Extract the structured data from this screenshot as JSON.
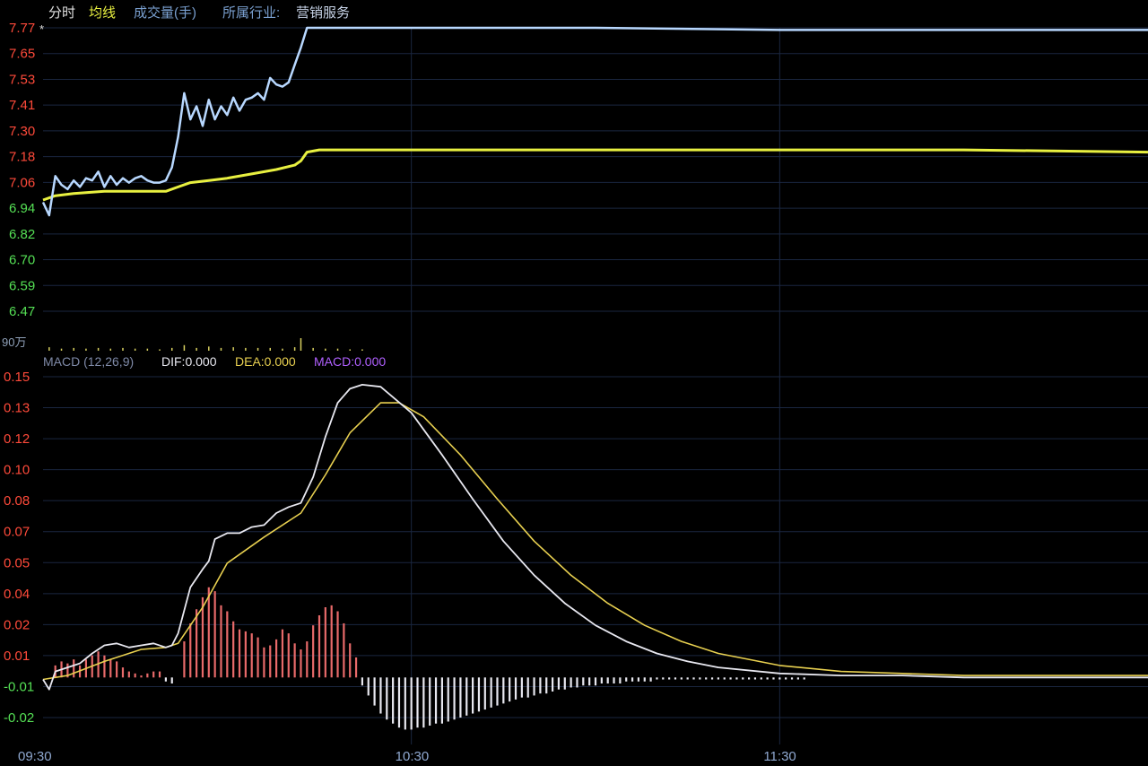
{
  "header": {
    "tab_timeshare": "分时",
    "tab_avg": "均线",
    "volume_label": "成交量(手)",
    "industry_label": "所属行业:",
    "industry_value": "营销服务"
  },
  "colors": {
    "price": "#b8d8ff",
    "avg": "#e8f040",
    "up": "#ff4a3a",
    "down": "#55e055",
    "dif": "#e8e8f0",
    "dea": "#e8d050",
    "macd_label": "#b060ff",
    "macd_pos_bar": "#e86a6a",
    "macd_neg_bar": "#e8e8f0",
    "grid": "#1a2640",
    "volume_bar": "#d8d060"
  },
  "volume_axis_label": "90万",
  "macd_header": {
    "name": "MACD (12,26,9)",
    "dif": "DIF:0.000",
    "dea": "DEA:0.000",
    "macd": "MACD:0.000"
  },
  "chart_data": [
    {
      "type": "line",
      "panel": "intraday price",
      "y_ticks": [
        "7.77",
        "7.65",
        "7.53",
        "7.41",
        "7.30",
        "7.18",
        "7.06",
        "6.94",
        "6.82",
        "6.70",
        "6.59",
        "6.47"
      ],
      "ylim": [
        6.47,
        7.77
      ],
      "x_ticks": [
        "09:30",
        "10:30",
        "11:30"
      ],
      "series": [
        {
          "name": "分时",
          "x": [
            0,
            1,
            2,
            3,
            4,
            5,
            6,
            7,
            8,
            9,
            10,
            11,
            12,
            13,
            14,
            15,
            16,
            17,
            18,
            19,
            20,
            21,
            22,
            23,
            24,
            25,
            26,
            27,
            28,
            29,
            30,
            31,
            32,
            33,
            34,
            35,
            36,
            37,
            38,
            39,
            40,
            41,
            42,
            43,
            44,
            45,
            48,
            60,
            90,
            120,
            150,
            180
          ],
          "values": [
            6.97,
            6.91,
            7.09,
            7.05,
            7.03,
            7.07,
            7.04,
            7.08,
            7.07,
            7.11,
            7.04,
            7.09,
            7.05,
            7.08,
            7.06,
            7.08,
            7.09,
            7.07,
            7.06,
            7.06,
            7.07,
            7.13,
            7.27,
            7.47,
            7.35,
            7.41,
            7.32,
            7.44,
            7.35,
            7.41,
            7.37,
            7.45,
            7.39,
            7.44,
            7.45,
            7.47,
            7.44,
            7.54,
            7.51,
            7.5,
            7.52,
            7.6,
            7.68,
            7.77,
            7.77,
            7.77,
            7.77,
            7.77,
            7.77,
            7.76,
            7.76,
            7.76
          ]
        },
        {
          "name": "均线",
          "x": [
            0,
            2,
            5,
            10,
            15,
            20,
            22,
            24,
            27,
            30,
            34,
            38,
            41,
            42,
            43,
            45,
            60,
            90,
            120,
            150,
            180
          ],
          "values": [
            6.98,
            7.0,
            7.01,
            7.02,
            7.02,
            7.02,
            7.04,
            7.06,
            7.07,
            7.08,
            7.1,
            7.12,
            7.14,
            7.16,
            7.2,
            7.21,
            7.21,
            7.21,
            7.21,
            7.21,
            7.2
          ]
        }
      ]
    },
    {
      "type": "bar",
      "panel": "volume",
      "y_label": "90万",
      "x": [
        1,
        3,
        5,
        7,
        9,
        11,
        13,
        15,
        17,
        19,
        21,
        23,
        25,
        27,
        29,
        31,
        33,
        35,
        37,
        39,
        41,
        42,
        44,
        46,
        48,
        50,
        52
      ],
      "values": [
        5,
        3,
        4,
        3,
        4,
        3,
        4,
        3,
        3,
        2,
        4,
        8,
        4,
        6,
        4,
        5,
        4,
        4,
        4,
        3,
        5,
        18,
        4,
        3,
        3,
        2,
        2
      ]
    },
    {
      "type": "line",
      "panel": "MACD",
      "y_ticks": [
        "0.15",
        "0.13",
        "0.12",
        "0.10",
        "0.08",
        "0.07",
        "0.05",
        "0.04",
        "0.02",
        "0.01",
        "-0.01",
        "-0.02"
      ],
      "ylim": [
        -0.02,
        0.15
      ],
      "series": [
        {
          "name": "DIF",
          "x": [
            0,
            1,
            2,
            4,
            6,
            8,
            10,
            12,
            14,
            16,
            18,
            20,
            21,
            22,
            24,
            26,
            27,
            28,
            30,
            32,
            34,
            36,
            38,
            40,
            42,
            44,
            46,
            48,
            50,
            52,
            55,
            60,
            65,
            70,
            75,
            80,
            85,
            90,
            95,
            100,
            105,
            110,
            120,
            130,
            140,
            150,
            160,
            170,
            180
          ],
          "values": [
            -0.001,
            -0.006,
            0.003,
            0.005,
            0.007,
            0.012,
            0.016,
            0.017,
            0.015,
            0.016,
            0.017,
            0.015,
            0.016,
            0.022,
            0.045,
            0.054,
            0.058,
            0.069,
            0.072,
            0.072,
            0.075,
            0.076,
            0.082,
            0.085,
            0.087,
            0.1,
            0.12,
            0.137,
            0.144,
            0.146,
            0.145,
            0.132,
            0.111,
            0.089,
            0.068,
            0.051,
            0.037,
            0.026,
            0.018,
            0.012,
            0.008,
            0.005,
            0.002,
            0.001,
            0.001,
            0.0,
            0.0,
            0.0,
            0.0
          ]
        },
        {
          "name": "DEA",
          "x": [
            0,
            4,
            10,
            16,
            20,
            22,
            26,
            30,
            36,
            42,
            46,
            50,
            55,
            58,
            62,
            68,
            74,
            80,
            86,
            92,
            98,
            104,
            110,
            120,
            130,
            140,
            150,
            160,
            170,
            180
          ],
          "values": [
            -0.001,
            0.001,
            0.008,
            0.014,
            0.015,
            0.017,
            0.035,
            0.057,
            0.07,
            0.082,
            0.101,
            0.122,
            0.137,
            0.137,
            0.13,
            0.111,
            0.089,
            0.068,
            0.051,
            0.037,
            0.026,
            0.018,
            0.012,
            0.006,
            0.003,
            0.002,
            0.001,
            0.001,
            0.001,
            0.001
          ]
        },
        {
          "name": "MACD",
          "type": "bar",
          "x": [
            2,
            3,
            4,
            5,
            6,
            7,
            8,
            9,
            10,
            11,
            12,
            13,
            14,
            15,
            16,
            17,
            18,
            19,
            20,
            21,
            23,
            24,
            25,
            26,
            27,
            28,
            29,
            30,
            31,
            32,
            33,
            34,
            35,
            36,
            37,
            38,
            39,
            40,
            41,
            42,
            43,
            44,
            45,
            46,
            47,
            48,
            49,
            50,
            51,
            52,
            53,
            54,
            55,
            56,
            57,
            58,
            59,
            60,
            61,
            62,
            63,
            64,
            65,
            66,
            67,
            68,
            69,
            70,
            71,
            72,
            73,
            74,
            75,
            76,
            77,
            78,
            79,
            80,
            81,
            82,
            83,
            84,
            85,
            86,
            87,
            88,
            89,
            90,
            91,
            92,
            93,
            94,
            95,
            96,
            97,
            98,
            99,
            100,
            101,
            102,
            103,
            104,
            105,
            106,
            107,
            108,
            109,
            110,
            111,
            112,
            113,
            114,
            115,
            116,
            117,
            118,
            119,
            120,
            121,
            122,
            123,
            124
          ],
          "values": [
            0.006,
            0.008,
            0.007,
            0.009,
            0.006,
            0.009,
            0.011,
            0.013,
            0.011,
            0.009,
            0.008,
            0.005,
            0.003,
            0.002,
            0.001,
            0.002,
            0.003,
            0.003,
            -0.002,
            -0.003,
            0.018,
            0.027,
            0.034,
            0.04,
            0.045,
            0.043,
            0.036,
            0.033,
            0.028,
            0.024,
            0.023,
            0.022,
            0.02,
            0.015,
            0.016,
            0.019,
            0.024,
            0.022,
            0.017,
            0.014,
            0.018,
            0.026,
            0.031,
            0.035,
            0.036,
            0.033,
            0.027,
            0.017,
            0.01,
            -0.004,
            -0.009,
            -0.014,
            -0.018,
            -0.021,
            -0.023,
            -0.025,
            -0.026,
            -0.026,
            -0.025,
            -0.025,
            -0.024,
            -0.023,
            -0.023,
            -0.022,
            -0.021,
            -0.02,
            -0.019,
            -0.018,
            -0.017,
            -0.016,
            -0.015,
            -0.014,
            -0.013,
            -0.012,
            -0.011,
            -0.01,
            -0.01,
            -0.009,
            -0.008,
            -0.008,
            -0.007,
            -0.006,
            -0.006,
            -0.005,
            -0.005,
            -0.004,
            -0.004,
            -0.004,
            -0.003,
            -0.003,
            -0.003,
            -0.003,
            -0.002,
            -0.002,
            -0.002,
            -0.002,
            -0.002,
            -0.001,
            -0.001,
            -0.001,
            -0.001,
            -0.001,
            -0.001,
            -0.001,
            -0.001,
            -0.001,
            -0.001,
            -0.001,
            -0.001,
            -0.001,
            -0.001,
            -0.001,
            -0.001,
            -0.001,
            -0.001,
            -0.001,
            -0.001,
            -0.001,
            -0.001,
            -0.001,
            -0.001,
            -0.001
          ]
        }
      ]
    }
  ]
}
